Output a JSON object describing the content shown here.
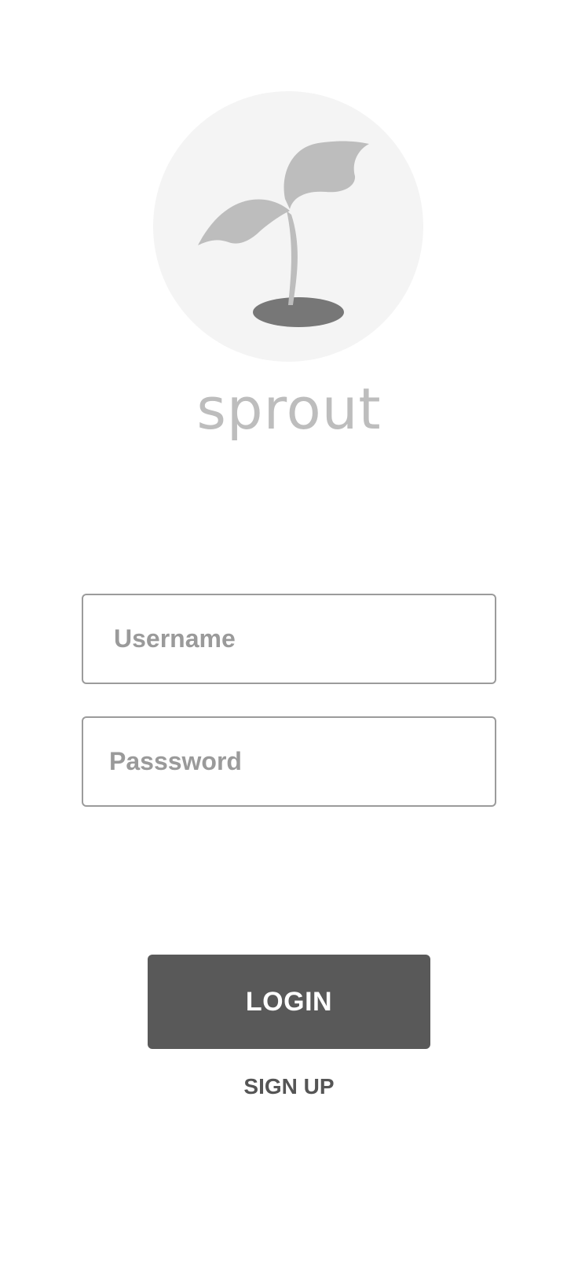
{
  "app": {
    "logo_icon": "sprout-icon",
    "brand_name": "sprout"
  },
  "login_form": {
    "username_placeholder": "Username",
    "username_value": "",
    "password_placeholder": "Passsword",
    "password_value": "",
    "login_label": "LOGIN",
    "signup_label": "SIGN UP"
  },
  "colors": {
    "logo_background": "#f4f4f4",
    "leaf": "#bdbdbd",
    "soil": "#777777",
    "brand_text": "#bdbdbd",
    "field_border": "#9b9b9b",
    "placeholder_text": "#9a9a9a",
    "button_background": "#595959",
    "button_text": "#ffffff",
    "link_text": "#555555"
  }
}
